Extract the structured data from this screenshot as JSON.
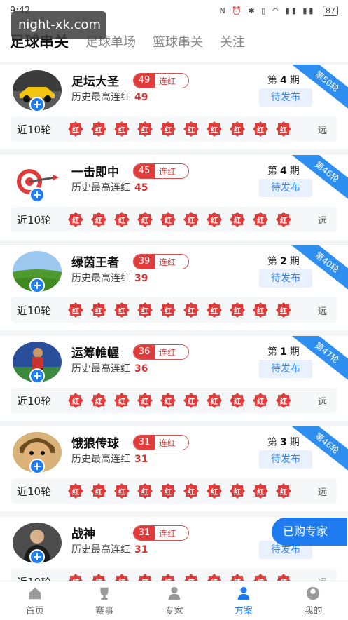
{
  "status": {
    "time": "9:42",
    "icons": "N ⏰ ✱ ▯ ◠ ▮▮ ▮▮",
    "battery": "87"
  },
  "watermark": "night-xk.com",
  "tabs": [
    {
      "label": "足球串关",
      "active": true
    },
    {
      "label": "足球单场",
      "active": false
    },
    {
      "label": "篮球串关",
      "active": false
    },
    {
      "label": "关注",
      "active": false
    }
  ],
  "recent_label": "近10轮",
  "badge_text": "红",
  "far_label": "远",
  "history_label": "历史最高连红",
  "streak_label": "连红",
  "pending_label": "待发布",
  "period_prefix": "第",
  "period_suffix": "期",
  "experts": [
    {
      "name": "足坛大圣",
      "streak": "49",
      "history": "49",
      "period": "4",
      "ribbon": "第50轮",
      "avatar": "car"
    },
    {
      "name": "一击即中",
      "streak": "45",
      "history": "45",
      "period": "4",
      "ribbon": "第46轮",
      "avatar": "target"
    },
    {
      "name": "绿茵王者",
      "streak": "39",
      "history": "39",
      "period": "2",
      "ribbon": "第40轮",
      "avatar": "field"
    },
    {
      "name": "运筹帷幄",
      "streak": "36",
      "history": "36",
      "period": "1",
      "ribbon": "第47轮",
      "avatar": "player"
    },
    {
      "name": "饿狼传球",
      "streak": "31",
      "history": "31",
      "period": "3",
      "ribbon": "第46轮",
      "avatar": "face"
    },
    {
      "name": "战神",
      "streak": "31",
      "history": "31",
      "period": "",
      "ribbon": "",
      "avatar": "man"
    }
  ],
  "float_button": "已购专家",
  "nav": [
    {
      "label": "首页",
      "icon": "home-icon",
      "active": false
    },
    {
      "label": "赛事",
      "icon": "trophy-icon",
      "active": false
    },
    {
      "label": "专家",
      "icon": "expert-icon",
      "active": false
    },
    {
      "label": "方案",
      "icon": "plan-icon",
      "active": true
    },
    {
      "label": "我的",
      "icon": "profile-icon",
      "active": false
    }
  ],
  "colors": {
    "accent": "#1f7cf0",
    "red": "#e03c3c"
  }
}
